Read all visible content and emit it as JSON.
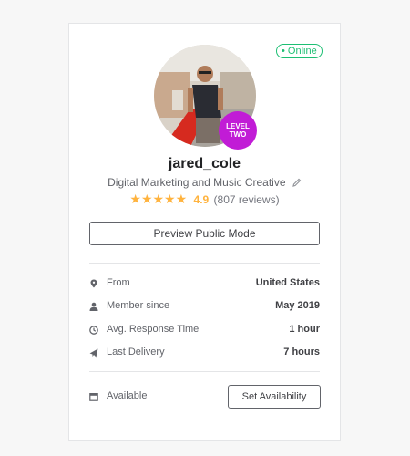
{
  "profile": {
    "status": "• Online",
    "level_line1": "LEVEL",
    "level_line2": "TWO",
    "username": "jared_cole",
    "tagline": "Digital Marketing and Music Creative",
    "stars": "★★★★★",
    "rating": "4.9",
    "reviews": "(807 reviews)",
    "preview_label": "Preview Public Mode"
  },
  "info": [
    {
      "label": "From",
      "value": "United States",
      "icon": "location-pin-icon"
    },
    {
      "label": "Member since",
      "value": "May 2019",
      "icon": "user-icon"
    },
    {
      "label": "Avg. Response Time",
      "value": "1 hour",
      "icon": "clock-icon"
    },
    {
      "label": "Last Delivery",
      "value": "7 hours",
      "icon": "paper-plane-icon"
    }
  ],
  "availability": {
    "label": "Available",
    "button_label": "Set Availability"
  },
  "colors": {
    "online_green": "#1dbf73",
    "level_badge": "#c11cd6",
    "star": "#ffb33e"
  }
}
